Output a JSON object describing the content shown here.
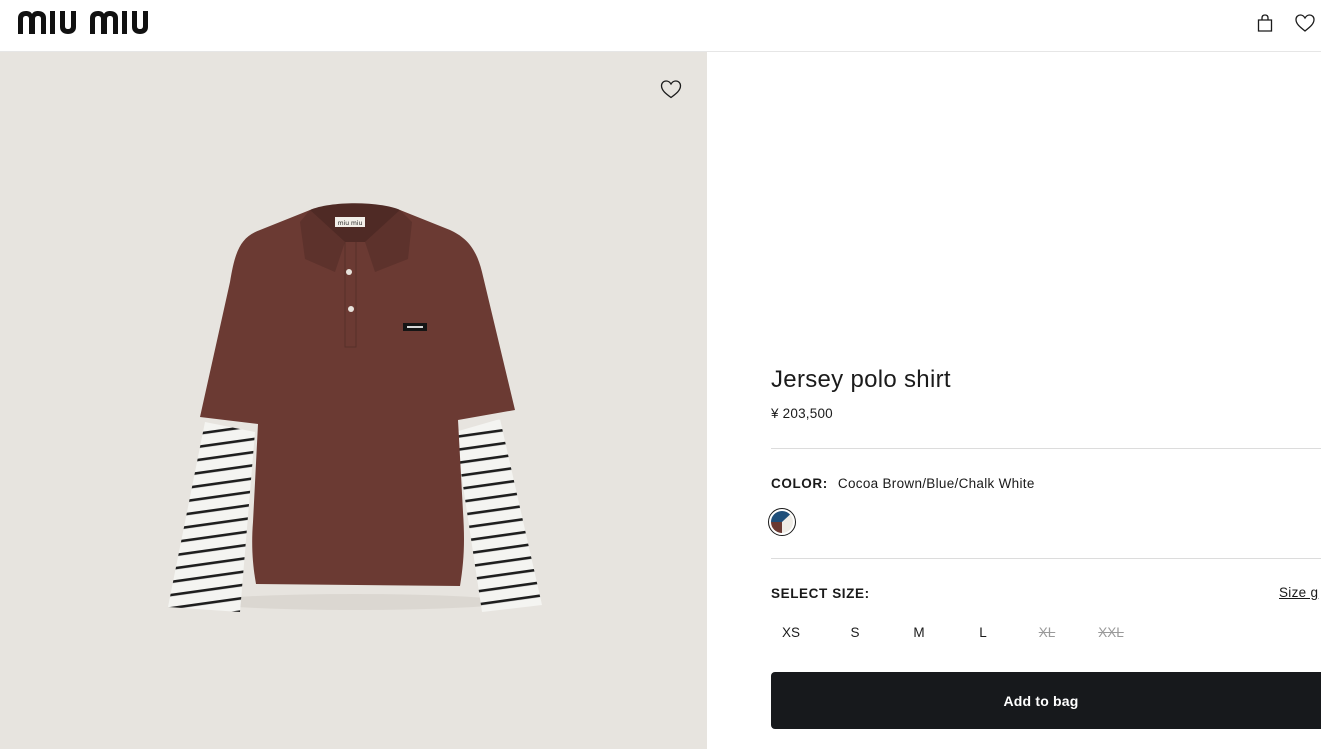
{
  "brand": {
    "logo_text": "miu miu"
  },
  "header": {
    "icons": [
      "bag-icon",
      "heart-icon"
    ]
  },
  "gallery": {
    "wishlist_icon": "heart-icon",
    "background": "#e7e4df",
    "product_colors": {
      "body": "#6b3a33",
      "stripe_dark": "#1e1e1e",
      "stripe_light": "#f4f4f1"
    }
  },
  "product": {
    "title": "Jersey polo shirt",
    "price": "¥ 203,500",
    "color": {
      "label": "COLOR:",
      "value": "Cocoa Brown/Blue/Chalk White",
      "swatch_colors": [
        "#6b3a33",
        "#1f4f7a",
        "#efece6"
      ]
    },
    "size": {
      "label": "SELECT SIZE:",
      "guide_label": "Size g",
      "options": [
        {
          "label": "XS",
          "available": true
        },
        {
          "label": "S",
          "available": true
        },
        {
          "label": "M",
          "available": true
        },
        {
          "label": "L",
          "available": true
        },
        {
          "label": "XL",
          "available": false
        },
        {
          "label": "XXL",
          "available": false
        }
      ]
    },
    "add_to_bag_label": "Add to bag"
  }
}
